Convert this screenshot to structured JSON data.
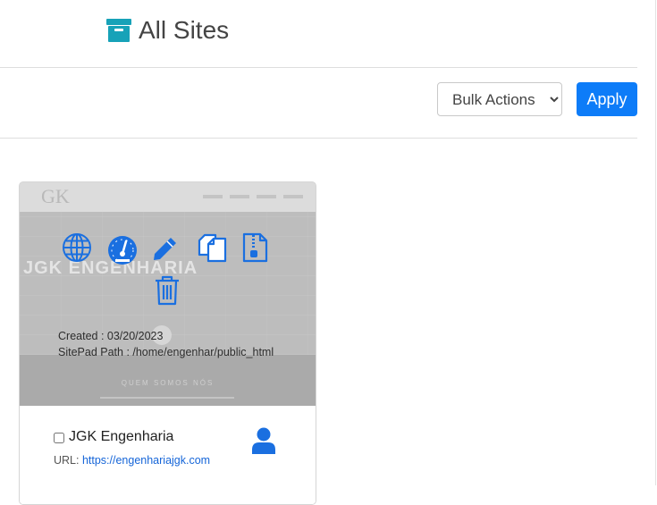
{
  "header": {
    "title": "All Sites",
    "icon": "archive-box-icon"
  },
  "toolbar": {
    "bulk_actions": {
      "selected": "Bulk Actions"
    },
    "apply_label": "Apply"
  },
  "site": {
    "thumbnail": {
      "brand_text": "JGK ENGENHARIA",
      "logo_text": "GK",
      "band_text": "QUEM SOMOS NÓS"
    },
    "actions": [
      {
        "icon": "globe-icon"
      },
      {
        "icon": "dashboard-gauge-icon"
      },
      {
        "icon": "pencil-edit-icon"
      },
      {
        "icon": "copy-clone-icon"
      },
      {
        "icon": "zip-file-icon"
      },
      {
        "icon": "trash-icon"
      }
    ],
    "created_line": "Created : 03/20/2023",
    "path_line": "SitePad Path : /home/engenhar/public_html",
    "name": "JGK Engenharia",
    "url_label": "URL: ",
    "url": "https://engenhariajgk.com",
    "owner_icon": "user-icon"
  },
  "colors": {
    "accent": "#0d7cf8",
    "link": "#1565d8",
    "icon_blue": "#1a6fe0"
  }
}
